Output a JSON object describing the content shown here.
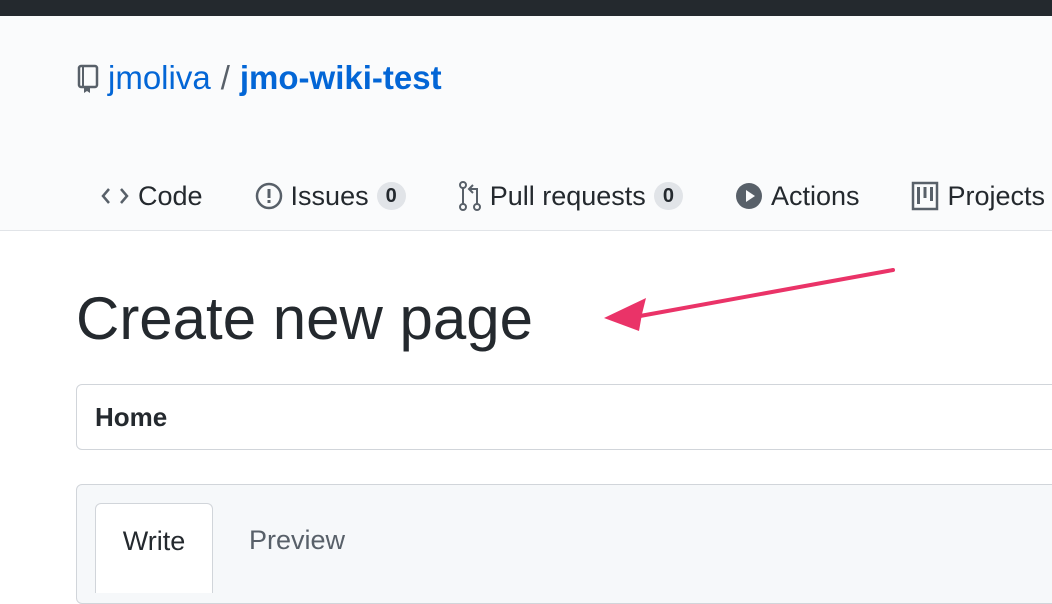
{
  "repo": {
    "owner": "jmoliva",
    "separator": "/",
    "name": "jmo-wiki-test"
  },
  "nav": [
    {
      "label": "Code",
      "icon": "code-icon"
    },
    {
      "label": "Issues",
      "count": "0",
      "icon": "issue-opened-icon"
    },
    {
      "label": "Pull requests",
      "count": "0",
      "icon": "git-pull-request-icon"
    },
    {
      "label": "Actions",
      "icon": "play-icon"
    },
    {
      "label": "Projects",
      "icon": "project-icon"
    }
  ],
  "page": {
    "title": "Create new page",
    "name_value": "Home",
    "tabs": {
      "write": "Write",
      "preview": "Preview"
    }
  },
  "colors": {
    "link": "#0366d6",
    "annotation_arrow": "#ea3368",
    "header_bg": "#fafbfc",
    "topbar": "#24292e"
  }
}
